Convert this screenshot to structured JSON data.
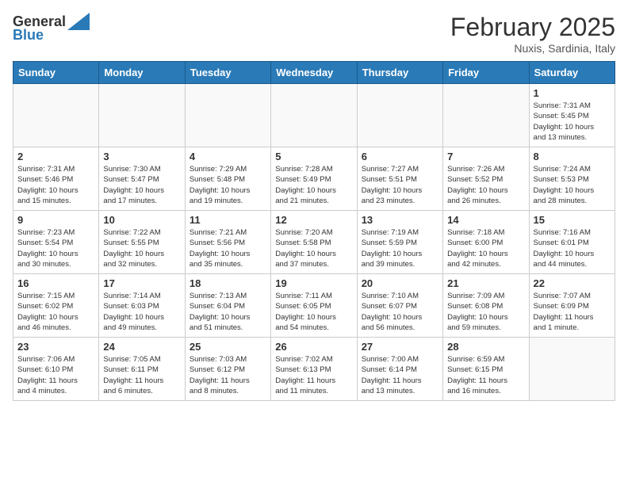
{
  "logo": {
    "general": "General",
    "blue": "Blue"
  },
  "header": {
    "month": "February 2025",
    "location": "Nuxis, Sardinia, Italy"
  },
  "weekdays": [
    "Sunday",
    "Monday",
    "Tuesday",
    "Wednesday",
    "Thursday",
    "Friday",
    "Saturday"
  ],
  "weeks": [
    [
      {
        "day": "",
        "info": ""
      },
      {
        "day": "",
        "info": ""
      },
      {
        "day": "",
        "info": ""
      },
      {
        "day": "",
        "info": ""
      },
      {
        "day": "",
        "info": ""
      },
      {
        "day": "",
        "info": ""
      },
      {
        "day": "1",
        "info": "Sunrise: 7:31 AM\nSunset: 5:45 PM\nDaylight: 10 hours\nand 13 minutes."
      }
    ],
    [
      {
        "day": "2",
        "info": "Sunrise: 7:31 AM\nSunset: 5:46 PM\nDaylight: 10 hours\nand 15 minutes."
      },
      {
        "day": "3",
        "info": "Sunrise: 7:30 AM\nSunset: 5:47 PM\nDaylight: 10 hours\nand 17 minutes."
      },
      {
        "day": "4",
        "info": "Sunrise: 7:29 AM\nSunset: 5:48 PM\nDaylight: 10 hours\nand 19 minutes."
      },
      {
        "day": "5",
        "info": "Sunrise: 7:28 AM\nSunset: 5:49 PM\nDaylight: 10 hours\nand 21 minutes."
      },
      {
        "day": "6",
        "info": "Sunrise: 7:27 AM\nSunset: 5:51 PM\nDaylight: 10 hours\nand 23 minutes."
      },
      {
        "day": "7",
        "info": "Sunrise: 7:26 AM\nSunset: 5:52 PM\nDaylight: 10 hours\nand 26 minutes."
      },
      {
        "day": "8",
        "info": "Sunrise: 7:24 AM\nSunset: 5:53 PM\nDaylight: 10 hours\nand 28 minutes."
      }
    ],
    [
      {
        "day": "9",
        "info": "Sunrise: 7:23 AM\nSunset: 5:54 PM\nDaylight: 10 hours\nand 30 minutes."
      },
      {
        "day": "10",
        "info": "Sunrise: 7:22 AM\nSunset: 5:55 PM\nDaylight: 10 hours\nand 32 minutes."
      },
      {
        "day": "11",
        "info": "Sunrise: 7:21 AM\nSunset: 5:56 PM\nDaylight: 10 hours\nand 35 minutes."
      },
      {
        "day": "12",
        "info": "Sunrise: 7:20 AM\nSunset: 5:58 PM\nDaylight: 10 hours\nand 37 minutes."
      },
      {
        "day": "13",
        "info": "Sunrise: 7:19 AM\nSunset: 5:59 PM\nDaylight: 10 hours\nand 39 minutes."
      },
      {
        "day": "14",
        "info": "Sunrise: 7:18 AM\nSunset: 6:00 PM\nDaylight: 10 hours\nand 42 minutes."
      },
      {
        "day": "15",
        "info": "Sunrise: 7:16 AM\nSunset: 6:01 PM\nDaylight: 10 hours\nand 44 minutes."
      }
    ],
    [
      {
        "day": "16",
        "info": "Sunrise: 7:15 AM\nSunset: 6:02 PM\nDaylight: 10 hours\nand 46 minutes."
      },
      {
        "day": "17",
        "info": "Sunrise: 7:14 AM\nSunset: 6:03 PM\nDaylight: 10 hours\nand 49 minutes."
      },
      {
        "day": "18",
        "info": "Sunrise: 7:13 AM\nSunset: 6:04 PM\nDaylight: 10 hours\nand 51 minutes."
      },
      {
        "day": "19",
        "info": "Sunrise: 7:11 AM\nSunset: 6:05 PM\nDaylight: 10 hours\nand 54 minutes."
      },
      {
        "day": "20",
        "info": "Sunrise: 7:10 AM\nSunset: 6:07 PM\nDaylight: 10 hours\nand 56 minutes."
      },
      {
        "day": "21",
        "info": "Sunrise: 7:09 AM\nSunset: 6:08 PM\nDaylight: 10 hours\nand 59 minutes."
      },
      {
        "day": "22",
        "info": "Sunrise: 7:07 AM\nSunset: 6:09 PM\nDaylight: 11 hours\nand 1 minute."
      }
    ],
    [
      {
        "day": "23",
        "info": "Sunrise: 7:06 AM\nSunset: 6:10 PM\nDaylight: 11 hours\nand 4 minutes."
      },
      {
        "day": "24",
        "info": "Sunrise: 7:05 AM\nSunset: 6:11 PM\nDaylight: 11 hours\nand 6 minutes."
      },
      {
        "day": "25",
        "info": "Sunrise: 7:03 AM\nSunset: 6:12 PM\nDaylight: 11 hours\nand 8 minutes."
      },
      {
        "day": "26",
        "info": "Sunrise: 7:02 AM\nSunset: 6:13 PM\nDaylight: 11 hours\nand 11 minutes."
      },
      {
        "day": "27",
        "info": "Sunrise: 7:00 AM\nSunset: 6:14 PM\nDaylight: 11 hours\nand 13 minutes."
      },
      {
        "day": "28",
        "info": "Sunrise: 6:59 AM\nSunset: 6:15 PM\nDaylight: 11 hours\nand 16 minutes."
      },
      {
        "day": "",
        "info": ""
      }
    ]
  ]
}
